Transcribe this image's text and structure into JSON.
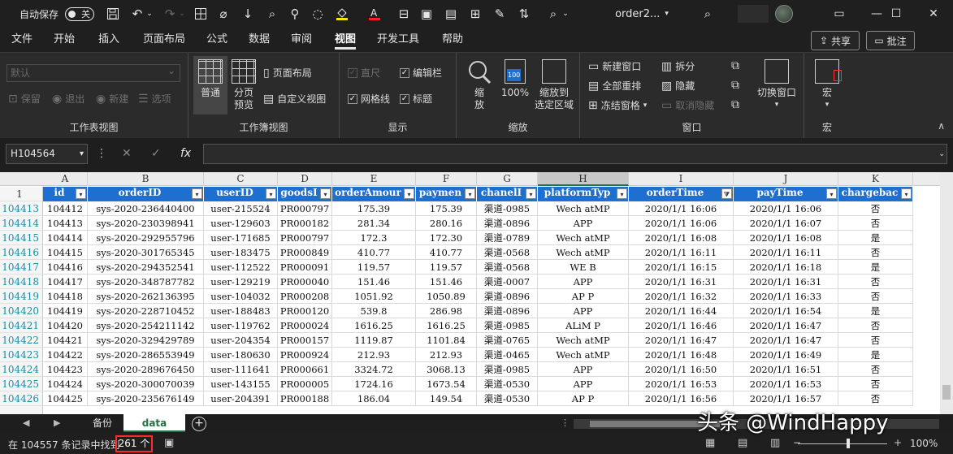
{
  "titlebar": {
    "autosave_label": "自动保存",
    "autosave_state": "关",
    "doc_title": "order2...",
    "qat_icons": [
      "save-icon",
      "undo-icon",
      "redo-icon",
      "borders-icon",
      "clear-format-icon",
      "sort-asc-icon",
      "find-icon",
      "fill-color-icon",
      "font-color-icon",
      "merge-icon",
      "table-icon",
      "grid-icon",
      "format-painter-icon",
      "sort-desc-icon",
      "search-icon",
      "more-icon"
    ],
    "search_icon": "search-icon"
  },
  "menu": {
    "tabs": [
      "文件",
      "开始",
      "插入",
      "页面布局",
      "公式",
      "数据",
      "审阅",
      "视图",
      "开发工具",
      "帮助"
    ],
    "active": "视图",
    "share_label": "共享",
    "comment_label": "批注"
  },
  "ribbon": {
    "sheet_view": {
      "combo_value": "默认",
      "keep": "保留",
      "exit": "退出",
      "new": "新建",
      "options": "选项",
      "label": "工作表视图"
    },
    "workbook_views": {
      "normal": "普通",
      "page_break": "分页\n预览",
      "page_layout": "页面布局",
      "custom_view": "自定义视图",
      "label": "工作簿视图"
    },
    "show": {
      "ruler": "直尺",
      "formula_bar": "编辑栏",
      "gridlines": "网格线",
      "headings": "标题",
      "label": "显示"
    },
    "zoom": {
      "zoom": "缩\n放",
      "hundred": "100%",
      "icon_text": "100",
      "to_selection": "缩放到\n选定区域",
      "label": "缩放"
    },
    "window": {
      "new_window": "新建窗口",
      "arrange_all": "全部重排",
      "freeze_panes": "冻结窗格",
      "split": "拆分",
      "hide": "隐藏",
      "unhide": "取消隐藏",
      "switch_window": "切换窗口",
      "label": "窗口"
    },
    "macros": {
      "macro": "宏",
      "label": "宏"
    }
  },
  "formula_bar": {
    "name_box": "H104564",
    "formula": ""
  },
  "grid": {
    "columns": [
      "A",
      "B",
      "C",
      "D",
      "E",
      "F",
      "G",
      "H",
      "I",
      "J",
      "K"
    ],
    "selected_column": "H",
    "header_row_number": "1",
    "headers": [
      "id",
      "orderID",
      "userID",
      "goodsI",
      "orderAmour",
      "paymen",
      "chanelI",
      "platformTyp",
      "orderTime",
      "payTime",
      "chargebac"
    ],
    "rows": [
      {
        "rn": "104413",
        "c": [
          "104412",
          "sys-2020-236440400",
          "user-215524",
          "PR000797",
          "175.39",
          "175.39",
          "渠道-0985",
          "Wech atMP",
          "2020/1/1 16:06",
          "2020/1/1 16:06",
          "否"
        ]
      },
      {
        "rn": "104414",
        "c": [
          "104413",
          "sys-2020-230398941",
          "user-129603",
          "PR000182",
          "281.34",
          "280.16",
          "渠道-0896",
          "APP",
          "2020/1/1 16:06",
          "2020/1/1 16:07",
          "否"
        ]
      },
      {
        "rn": "104415",
        "c": [
          "104414",
          "sys-2020-292955796",
          "user-171685",
          "PR000797",
          "172.3",
          "172.30",
          "渠道-0789",
          "Wech atMP",
          "2020/1/1 16:08",
          "2020/1/1 16:08",
          "是"
        ]
      },
      {
        "rn": "104416",
        "c": [
          "104415",
          "sys-2020-301765345",
          "user-183475",
          "PR000849",
          "410.77",
          "410.77",
          "渠道-0568",
          "Wech atMP",
          "2020/1/1 16:11",
          "2020/1/1 16:11",
          "否"
        ]
      },
      {
        "rn": "104417",
        "c": [
          "104416",
          "sys-2020-294352541",
          "user-112522",
          "PR000091",
          "119.57",
          "119.57",
          "渠道-0568",
          "WE B",
          "2020/1/1 16:15",
          "2020/1/1 16:18",
          "是"
        ]
      },
      {
        "rn": "104418",
        "c": [
          "104417",
          "sys-2020-348787782",
          "user-129219",
          "PR000040",
          "151.46",
          "151.46",
          "渠道-0007",
          "APP",
          "2020/1/1 16:31",
          "2020/1/1 16:31",
          "否"
        ]
      },
      {
        "rn": "104419",
        "c": [
          "104418",
          "sys-2020-262136395",
          "user-104032",
          "PR000208",
          "1051.92",
          "1050.89",
          "渠道-0896",
          "AP P",
          "2020/1/1 16:32",
          "2020/1/1 16:33",
          "否"
        ]
      },
      {
        "rn": "104420",
        "c": [
          "104419",
          "sys-2020-228710452",
          "user-188483",
          "PR000120",
          "539.8",
          "286.98",
          "渠道-0896",
          "APP",
          "2020/1/1 16:44",
          "2020/1/1 16:54",
          "是"
        ]
      },
      {
        "rn": "104421",
        "c": [
          "104420",
          "sys-2020-254211142",
          "user-119762",
          "PR000024",
          "1616.25",
          "1616.25",
          "渠道-0985",
          "ALiM P",
          "2020/1/1 16:46",
          "2020/1/1 16:47",
          "否"
        ]
      },
      {
        "rn": "104422",
        "c": [
          "104421",
          "sys-2020-329429789",
          "user-204354",
          "PR000157",
          "1119.87",
          "1101.84",
          "渠道-0765",
          "Wech atMP",
          "2020/1/1 16:47",
          "2020/1/1 16:47",
          "否"
        ]
      },
      {
        "rn": "104423",
        "c": [
          "104422",
          "sys-2020-286553949",
          "user-180630",
          "PR000924",
          "212.93",
          "212.93",
          "渠道-0465",
          "Wech atMP",
          "2020/1/1 16:48",
          "2020/1/1 16:49",
          "是"
        ]
      },
      {
        "rn": "104424",
        "c": [
          "104423",
          "sys-2020-289676450",
          "user-111641",
          "PR000661",
          "3324.72",
          "3068.13",
          "渠道-0985",
          "APP",
          "2020/1/1 16:50",
          "2020/1/1 16:51",
          "否"
        ]
      },
      {
        "rn": "104425",
        "c": [
          "104424",
          "sys-2020-300070039",
          "user-143155",
          "PR000005",
          "1724.16",
          "1673.54",
          "渠道-0530",
          "APP",
          "2020/1/1 16:53",
          "2020/1/1 16:53",
          "否"
        ]
      },
      {
        "rn": "104426",
        "c": [
          "104425",
          "sys-2020-235676149",
          "user-204391",
          "PR000188",
          "186.04",
          "149.54",
          "渠道-0530",
          "AP P",
          "2020/1/1 16:56",
          "2020/1/1 16:57",
          "否"
        ]
      }
    ]
  },
  "sheets": {
    "tabs": [
      "备份",
      "data"
    ],
    "active": "data"
  },
  "status": {
    "text": "在 104557 条记录中找到",
    "count": "261 个",
    "zoom": "100%"
  },
  "watermark": "头条 @WindHappy",
  "colors": {
    "header_blue": "#1f6fd1",
    "row_number_teal": "#1a8ca0",
    "highlight_red": "#ff2a2a",
    "excel_green": "#217346"
  }
}
